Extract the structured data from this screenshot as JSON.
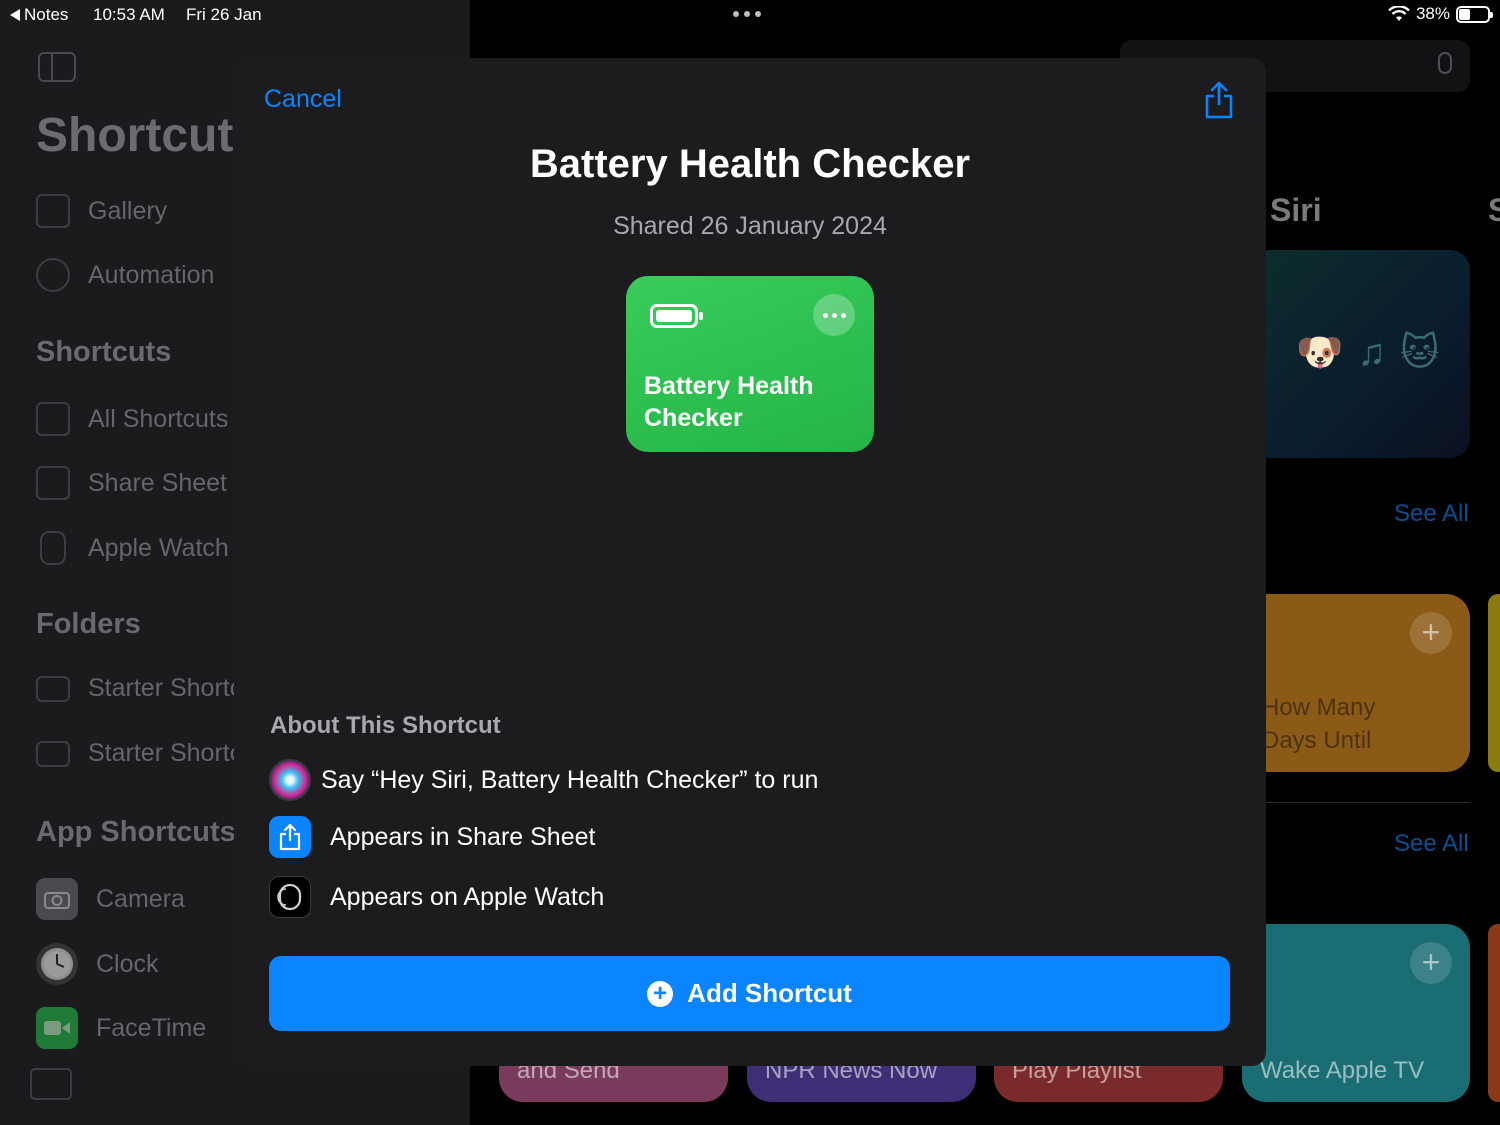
{
  "status_bar": {
    "back_app": "Notes",
    "time": "10:53 AM",
    "date": "Fri 26 Jan",
    "battery_percent": "38%",
    "battery_level": 0.38
  },
  "sidebar": {
    "title": "Shortcut",
    "top_items": [
      {
        "label": "Gallery",
        "icon": "gallery-icon"
      },
      {
        "label": "Automation",
        "icon": "automation-clock-icon"
      }
    ],
    "shortcuts_heading": "Shortcuts",
    "shortcut_items": [
      {
        "label": "All Shortcuts",
        "icon": "stack-icon"
      },
      {
        "label": "Share Sheet",
        "icon": "share-icon"
      },
      {
        "label": "Apple Watch",
        "icon": "watch-icon"
      }
    ],
    "folders_heading": "Folders",
    "folder_items": [
      {
        "label": "Starter Shortc",
        "icon": "folder-icon"
      },
      {
        "label": "Starter Shortc",
        "icon": "folder-icon"
      }
    ],
    "app_shortcuts_heading": "App Shortcuts",
    "app_items": [
      {
        "label": "Camera",
        "icon": "camera-icon",
        "color": "#4a4a4e"
      },
      {
        "label": "Clock",
        "icon": "clock-icon",
        "color": "#e5e5e5"
      },
      {
        "label": "FaceTime",
        "icon": "facetime-icon",
        "color": "#2e9c4a"
      }
    ]
  },
  "background": {
    "siri_heading": "Siri",
    "s_heading": "S",
    "see_all_1": "See All",
    "see_all_2": "See All",
    "tile_how_many_line1": "How Many",
    "tile_how_many_line2": "Days Until",
    "tile_wake": "Wake Apple TV",
    "bottom_tiles": [
      "and Send",
      "NPR News Now",
      "Play Playlist"
    ]
  },
  "sheet": {
    "cancel_label": "Cancel",
    "title": "Battery Health Checker",
    "subtitle": "Shared 26 January 2024",
    "card": {
      "name": "Battery Health Checker",
      "color": "#34c759",
      "icon": "battery-icon"
    },
    "about_heading": "About This Shortcut",
    "about_items": [
      {
        "text": "Say “Hey Siri, Battery Health Checker” to run",
        "icon": "siri-icon"
      },
      {
        "text": "Appears in Share Sheet",
        "icon": "share-icon"
      },
      {
        "text": "Appears on Apple Watch",
        "icon": "watch-icon"
      }
    ],
    "add_button_label": "Add Shortcut",
    "accent": "#0a84ff"
  }
}
